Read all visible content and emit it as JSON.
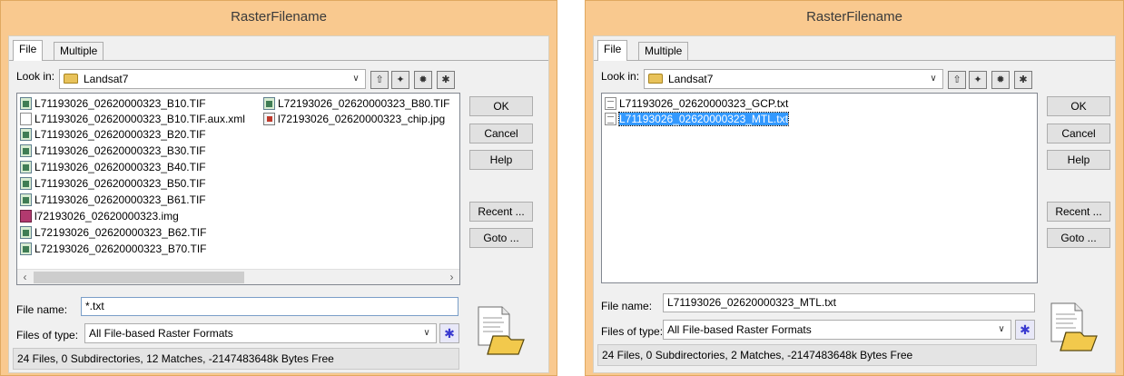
{
  "left": {
    "title": "RasterFilename",
    "tabs": [
      "File",
      "Multiple"
    ],
    "look_in_label": "Look in:",
    "look_in_value": "Landsat7",
    "files": [
      {
        "name": "L71193026_02620000323_B10.TIF",
        "icon": "tif-file-icon"
      },
      {
        "name": "L71193026_02620000323_B10.TIF.aux.xml",
        "icon": "document-icon"
      },
      {
        "name": "L71193026_02620000323_B20.TIF",
        "icon": "tif-file-icon"
      },
      {
        "name": "L71193026_02620000323_B30.TIF",
        "icon": "tif-file-icon"
      },
      {
        "name": "L71193026_02620000323_B40.TIF",
        "icon": "tif-file-icon"
      },
      {
        "name": "L71193026_02620000323_B50.TIF",
        "icon": "tif-file-icon"
      },
      {
        "name": "L71193026_02620000323_B61.TIF",
        "icon": "tif-file-icon"
      },
      {
        "name": "l72193026_02620000323.img",
        "icon": "img-file-icon"
      },
      {
        "name": "L72193026_02620000323_B62.TIF",
        "icon": "tif-file-icon"
      },
      {
        "name": "L72193026_02620000323_B70.TIF",
        "icon": "tif-file-icon"
      },
      {
        "name": "L72193026_02620000323_B80.TIF",
        "icon": "tif-file-icon"
      },
      {
        "name": "l72193026_02620000323_chip.jpg",
        "icon": "jpg-file-icon"
      }
    ],
    "buttons": {
      "ok": "OK",
      "cancel": "Cancel",
      "help": "Help",
      "recent": "Recent ...",
      "goto": "Goto ..."
    },
    "file_name_label": "File name:",
    "file_name_value": "*.txt",
    "files_of_type_label": "Files of type:",
    "files_of_type_value": "All File-based Raster Formats",
    "status": "24 Files, 0 Subdirectories, 12 Matches, -2147483648k Bytes Free"
  },
  "right": {
    "title": "RasterFilename",
    "tabs": [
      "File",
      "Multiple"
    ],
    "look_in_label": "Look in:",
    "look_in_value": "Landsat7",
    "files": [
      {
        "name": "L71193026_02620000323_GCP.txt",
        "icon": "txt-file-icon",
        "selected": false
      },
      {
        "name": "L71193026_02620000323_MTL.txt",
        "icon": "txt-file-icon",
        "selected": true
      }
    ],
    "buttons": {
      "ok": "OK",
      "cancel": "Cancel",
      "help": "Help",
      "recent": "Recent ...",
      "goto": "Goto ..."
    },
    "file_name_label": "File name:",
    "file_name_value": "L71193026_02620000323_MTL.txt",
    "files_of_type_label": "Files of type:",
    "files_of_type_value": "All File-based Raster Formats",
    "status": "24 Files, 0 Subdirectories, 2 Matches, -2147483648k Bytes Free"
  },
  "colors": {
    "title_bar": "#f9c98f",
    "selection": "#3399ff"
  }
}
